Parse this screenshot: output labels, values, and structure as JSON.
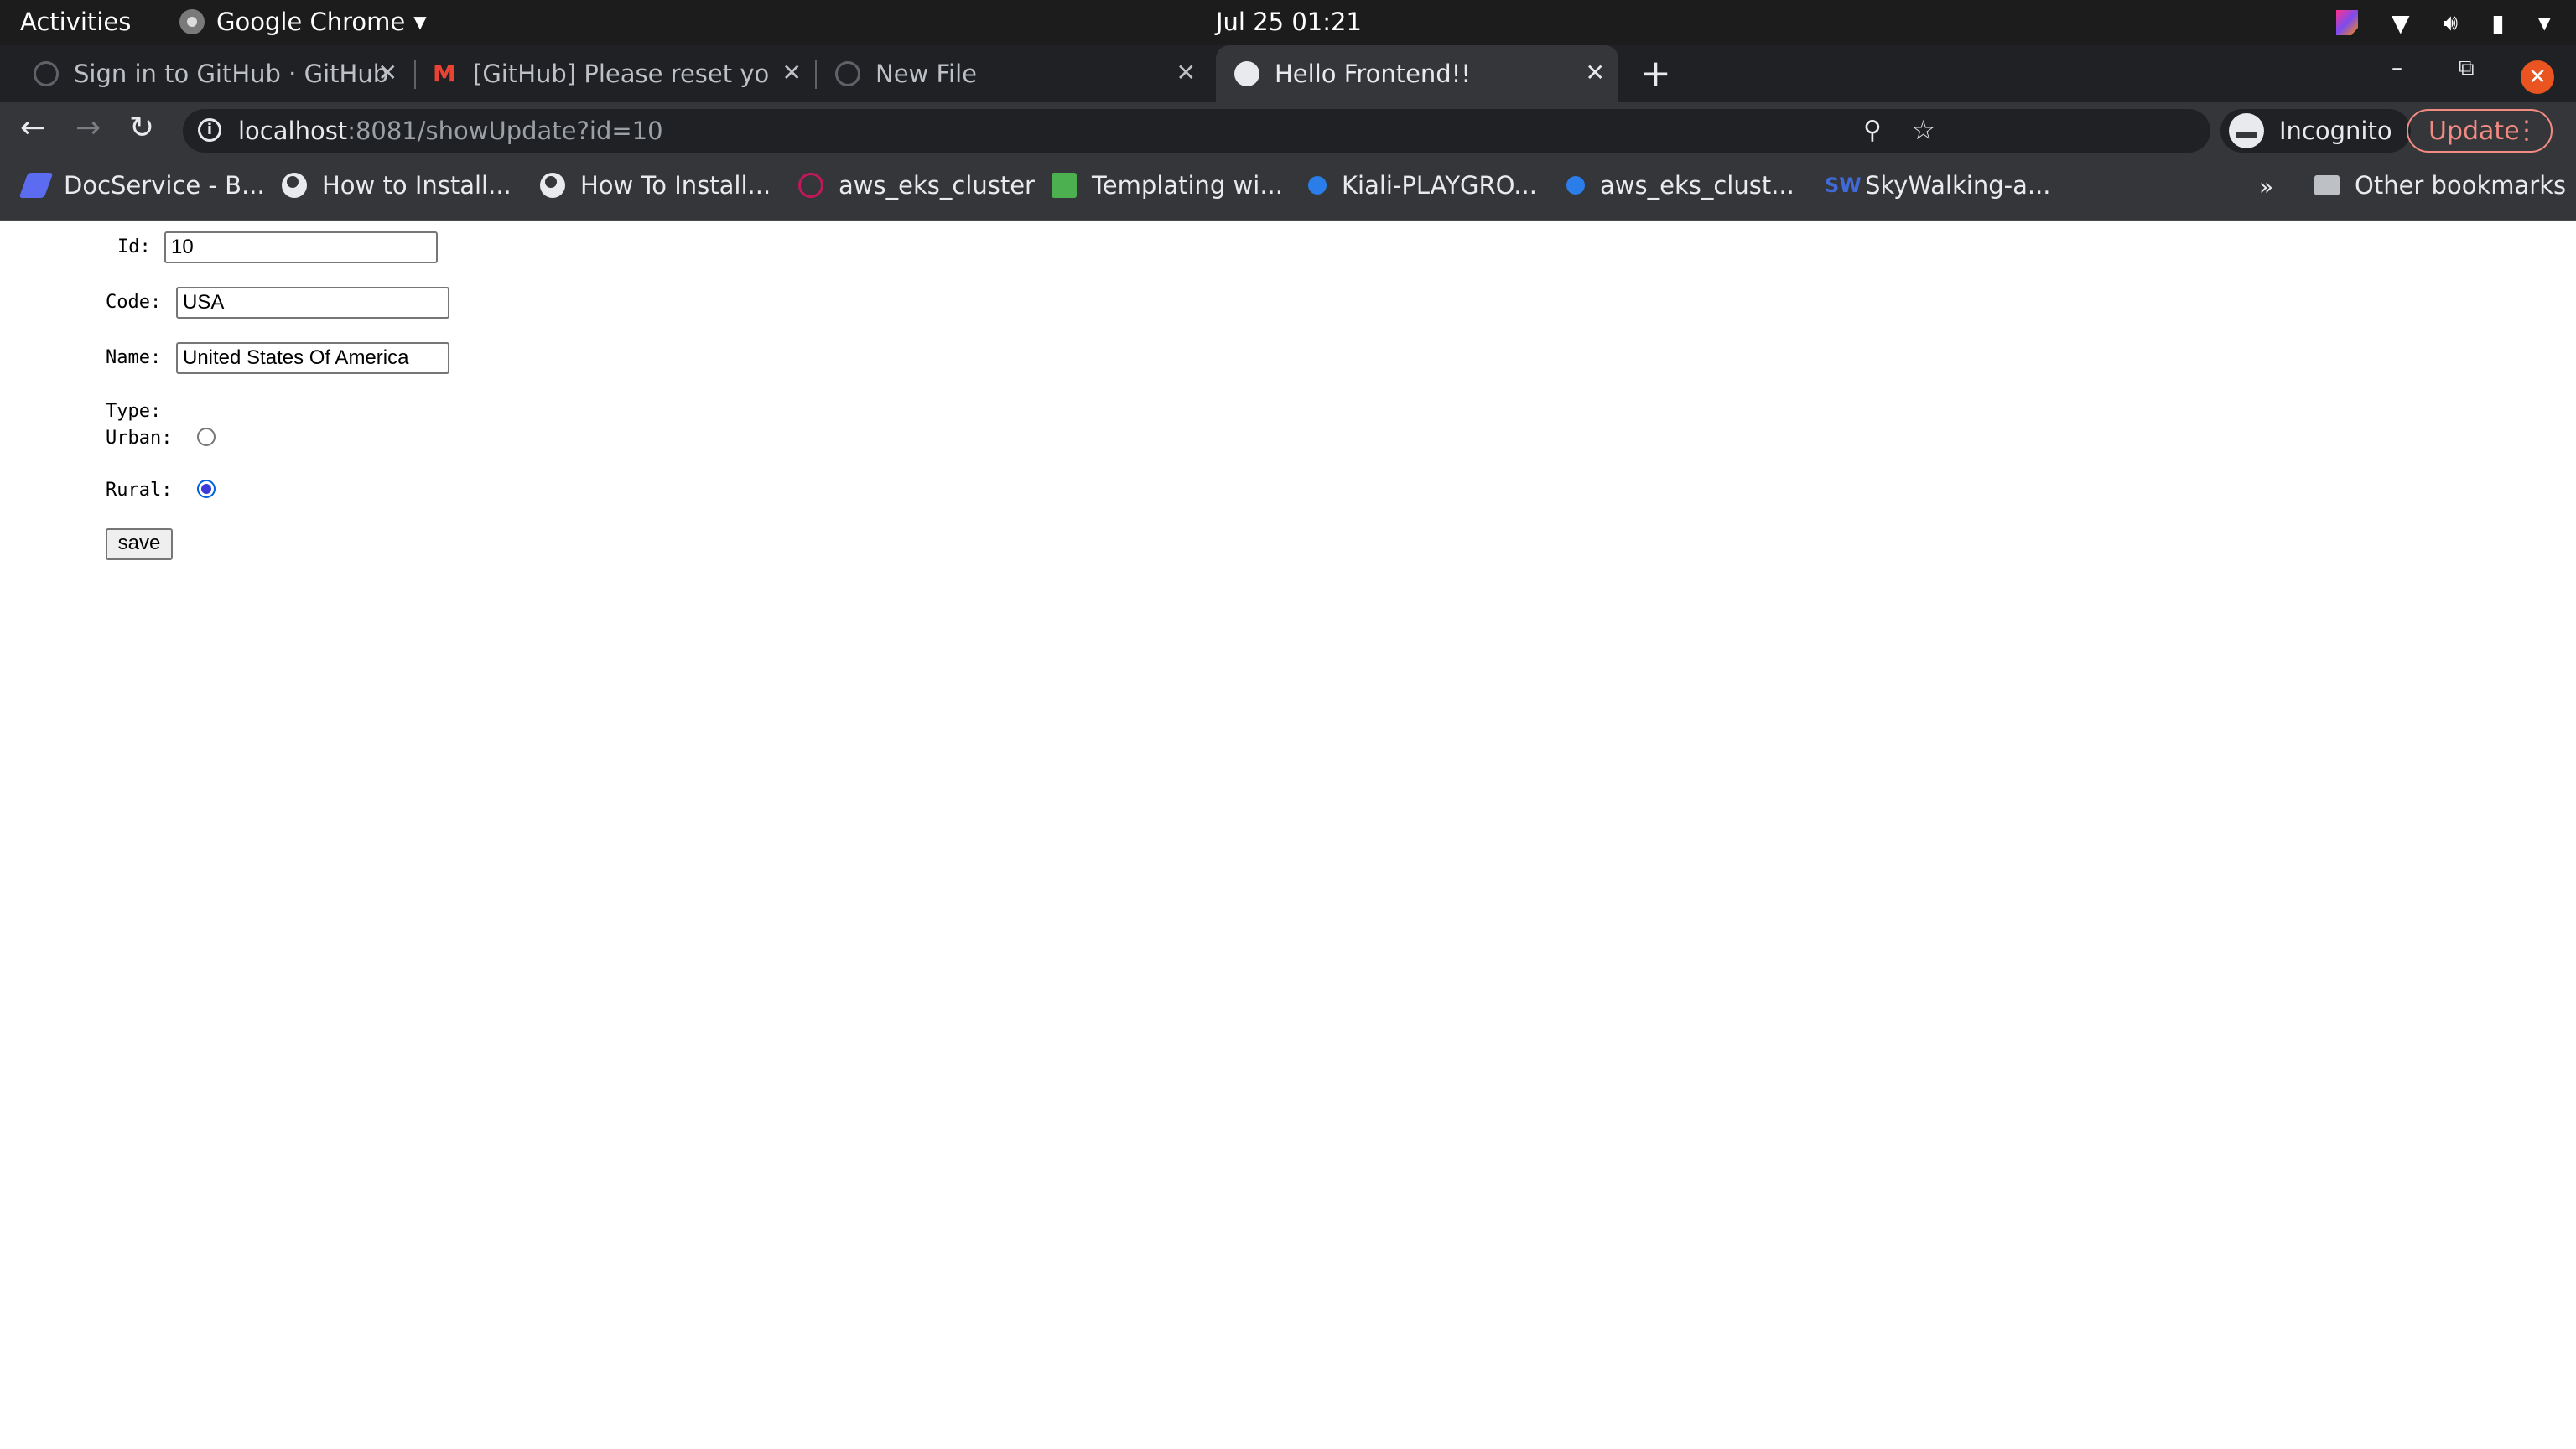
{
  "topbar": {
    "activities": "Activities",
    "app_name": "Google Chrome",
    "clock": "Jul 25  01:21"
  },
  "tabs": [
    {
      "title": "Sign in to GitHub · GitHub",
      "icon": "github-icon"
    },
    {
      "title": "[GitHub] Please reset you",
      "icon": "gmail-icon"
    },
    {
      "title": "New File",
      "icon": "github-icon"
    },
    {
      "title": "Hello Frontend!!",
      "icon": "globe-icon",
      "active": true
    }
  ],
  "omnibox": {
    "host": "localhost",
    "path": ":8081/showUpdate?id=10"
  },
  "profile": {
    "label": "Incognito"
  },
  "update_button": {
    "label": "Update"
  },
  "bookmarks": [
    {
      "label": "DocService - B...",
      "icon": "docservice-icon",
      "color": "#5b6cf0"
    },
    {
      "label": "How to Install...",
      "icon": "globe-icon"
    },
    {
      "label": "How To Install...",
      "icon": "globe-icon"
    },
    {
      "label": "aws_eks_cluster",
      "icon": "terraform-icon",
      "color": "#c2185b"
    },
    {
      "label": "Templating wi...",
      "icon": "leaf-icon",
      "color": "#4caf50"
    },
    {
      "label": "Kiali-PLAYGRO...",
      "icon": "kiali-icon",
      "color": "#2b7de9"
    },
    {
      "label": "aws_eks_clust...",
      "icon": "kiali-icon",
      "color": "#2b7de9"
    },
    {
      "label": "SkyWalking-a...",
      "icon": "skywalking-icon",
      "color": "#3f6ad8"
    }
  ],
  "other_bookmarks": "Other bookmarks",
  "form": {
    "id_label": "Id:",
    "id_value": "10",
    "code_label": "Code:",
    "code_value": "USA",
    "name_label": "Name:",
    "name_value": "United States Of America",
    "type_label": "Type:",
    "urban_label": "Urban:",
    "rural_label": "Rural:",
    "selected_type": "Rural",
    "save_label": "save"
  }
}
